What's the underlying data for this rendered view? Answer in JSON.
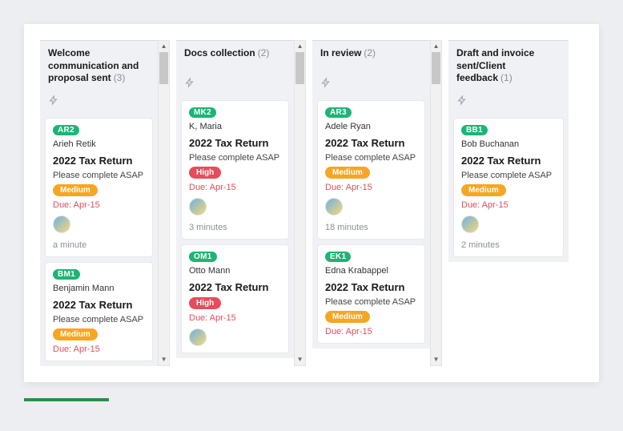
{
  "columns": [
    {
      "title": "Welcome communication and proposal sent",
      "count": "(3)",
      "cards": [
        {
          "badge": "AR2",
          "client": "Arieh Retik",
          "title": "2022 Tax Return",
          "desc": "Please complete ASAP",
          "priority": "Medium",
          "priorityClass": "medium",
          "due": "Due: Apr-15",
          "time": "a minute"
        },
        {
          "badge": "BM1",
          "client": "Benjamin Mann",
          "title": "2022 Tax Return",
          "desc": "Please complete ASAP",
          "priority": "Medium",
          "priorityClass": "medium",
          "due": "Due: Apr-15",
          "time": ""
        }
      ]
    },
    {
      "title": "Docs collection",
      "count": "(2)",
      "cards": [
        {
          "badge": "MK2",
          "client": "K, Maria",
          "title": "2022 Tax Return",
          "desc": "Please complete ASAP",
          "priority": "High",
          "priorityClass": "high",
          "due": "Due: Apr-15",
          "time": "3 minutes"
        },
        {
          "badge": "OM1",
          "client": "Otto Mann",
          "title": "2022 Tax Return",
          "desc": "",
          "priority": "High",
          "priorityClass": "high",
          "due": "Due: Apr-15",
          "time": ""
        }
      ]
    },
    {
      "title": "In review",
      "count": "(2)",
      "cards": [
        {
          "badge": "AR3",
          "client": "Adele Ryan",
          "title": "2022 Tax Return",
          "desc": "Please complete ASAP",
          "priority": "Medium",
          "priorityClass": "medium",
          "due": "Due: Apr-15",
          "time": "18 minutes"
        },
        {
          "badge": "EK1",
          "client": "Edna Krabappel",
          "title": "2022 Tax Return",
          "desc": "Please complete ASAP",
          "priority": "Medium",
          "priorityClass": "medium",
          "due": "Due: Apr-15",
          "time": ""
        }
      ]
    },
    {
      "title": "Draft and invoice sent/Client feedback",
      "count": "(1)",
      "cards": [
        {
          "badge": "BB1",
          "client": "Bob Buchanan",
          "title": "2022 Tax Return",
          "desc": "Please complete ASAP",
          "priority": "Medium",
          "priorityClass": "medium",
          "due": "Due: Apr-15",
          "time": "2 minutes"
        }
      ]
    }
  ]
}
